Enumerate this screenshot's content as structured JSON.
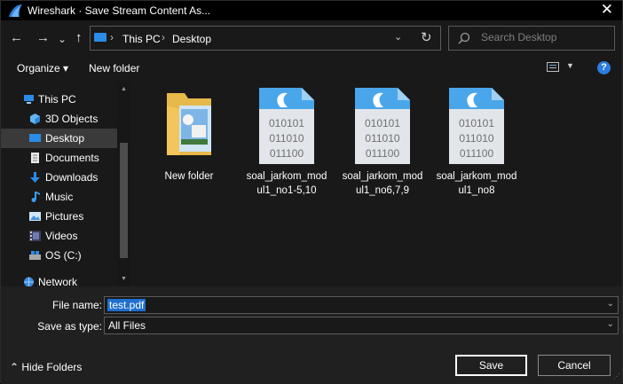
{
  "window": {
    "title": "Wireshark · Save Stream Content As...",
    "close_glyph": "✕",
    "app_icon": "wireshark-fin-icon"
  },
  "nav_buttons": {
    "back": "←",
    "forward": "→",
    "recent": "⌄",
    "up": "↑"
  },
  "address": {
    "crumbs": [
      "This PC",
      "Desktop"
    ],
    "separator": "›",
    "dropdown_glyph": "⌄",
    "refresh_glyph": "↻"
  },
  "search": {
    "placeholder": "Search Desktop"
  },
  "toolbar": {
    "organize_label": "Organize ▾",
    "new_folder_label": "New folder",
    "view_dropdown": "▼",
    "help_glyph": "?"
  },
  "nav_pane": {
    "items": [
      {
        "label": "This PC",
        "icon": "pc-icon"
      },
      {
        "label": "3D Objects",
        "icon": "cube-icon"
      },
      {
        "label": "Desktop",
        "icon": "desktop-icon",
        "selected": true
      },
      {
        "label": "Documents",
        "icon": "documents-icon"
      },
      {
        "label": "Downloads",
        "icon": "download-icon"
      },
      {
        "label": "Music",
        "icon": "music-icon"
      },
      {
        "label": "Pictures",
        "icon": "pictures-icon"
      },
      {
        "label": "Videos",
        "icon": "videos-icon"
      },
      {
        "label": "OS (C:)",
        "icon": "drive-icon"
      },
      {
        "label": "Network",
        "icon": "network-icon"
      }
    ]
  },
  "files": [
    {
      "name": "New folder",
      "type": "folder"
    },
    {
      "name": "soal_jarkom_modul1_no1-5,10",
      "type": "binary",
      "line1": "soal_jarkom_mod",
      "line2": "ul1_no1-5,10"
    },
    {
      "name": "soal_jarkom_modul1_no6,7,9",
      "type": "binary",
      "line1": "soal_jarkom_mod",
      "line2": "ul1_no6,7,9"
    },
    {
      "name": "soal_jarkom_modul1_no8",
      "type": "binary",
      "line1": "soal_jarkom_mod",
      "line2": "ul1_no8"
    }
  ],
  "binary_lines": [
    "010101",
    "011010",
    "011100"
  ],
  "form": {
    "file_name_label": "File name:",
    "file_name_value": "test.pdf",
    "save_type_label": "Save as type:",
    "save_type_value": "All Files",
    "caret": "⌄"
  },
  "footer": {
    "hide_folders": "⌃  Hide Folders",
    "save_label": "Save",
    "cancel_label": "Cancel"
  },
  "colors": {
    "accent": "#2a7ce0",
    "selection": "#1f6fcf",
    "background": "#191919"
  }
}
